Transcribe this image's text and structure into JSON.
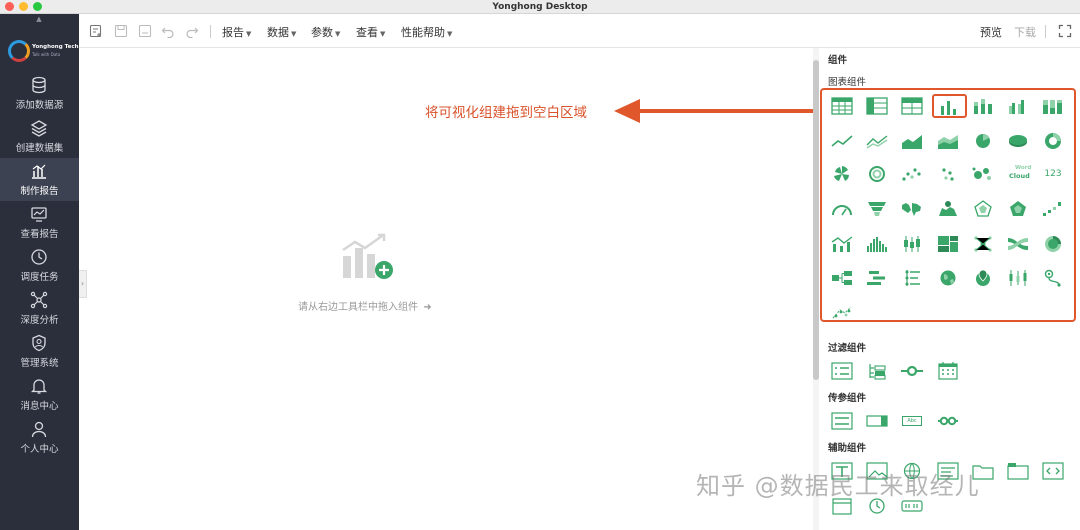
{
  "window": {
    "title": "Yonghong Desktop"
  },
  "logo": {
    "name": "Yonghong Tech",
    "tagline": "Talk with Data"
  },
  "sidebar": {
    "items": [
      {
        "label": "添加数据源",
        "icon": "database-icon"
      },
      {
        "label": "创建数据集",
        "icon": "layers-icon"
      },
      {
        "label": "制作报告",
        "icon": "bar-chart-icon",
        "active": true
      },
      {
        "label": "查看报告",
        "icon": "monitor-icon"
      },
      {
        "label": "调度任务",
        "icon": "clock-icon"
      },
      {
        "label": "深度分析",
        "icon": "network-icon"
      },
      {
        "label": "管理系统",
        "icon": "shield-user-icon"
      },
      {
        "label": "消息中心",
        "icon": "bell-icon"
      },
      {
        "label": "个人中心",
        "icon": "user-icon"
      }
    ]
  },
  "toolbar": {
    "menus": [
      "报告",
      "数据",
      "参数",
      "查看",
      "性能帮助"
    ],
    "preview": "预览",
    "download": "下载"
  },
  "canvas": {
    "hint": "请从右边工具栏中拖入组件"
  },
  "annotation": {
    "text": "将可视化组建拖到空白区域"
  },
  "panel": {
    "title": "组件",
    "chart_section": "图表组件",
    "filter_section": "过滤组件",
    "param_section": "传参组件",
    "aux_section": "辅助组件",
    "wordcloud_label_1": "Word",
    "wordcloud_label_2": "Cloud",
    "number_label": "123",
    "param_text_label": "Abc"
  },
  "colors": {
    "accent": "#e0572c",
    "icon_green": "#3aa66a",
    "sidebar_bg": "#2b2f3c"
  },
  "watermark": "知乎 @数据民工来取经儿"
}
